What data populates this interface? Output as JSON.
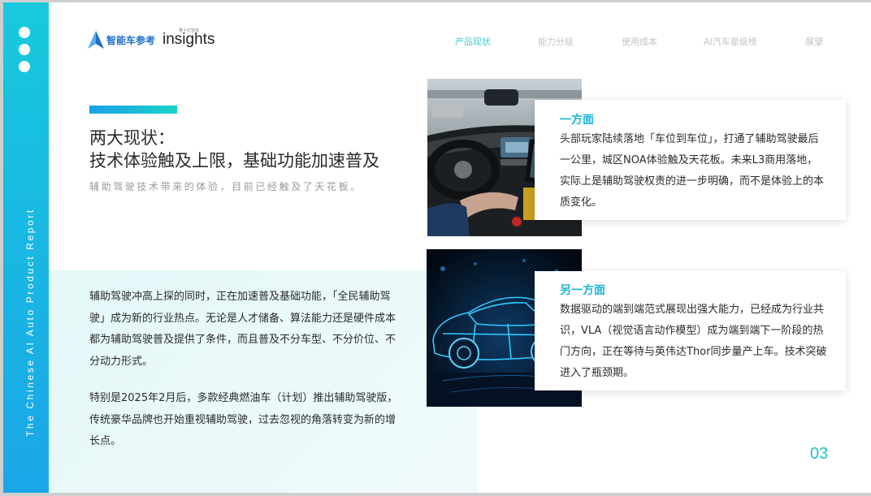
{
  "sidebar": {
    "vertical_text": "The Chinese AI Auto Product Report"
  },
  "logo": {
    "brand_cn": "智能车参考",
    "insights": "insights",
    "insights_tag": "量子位智库"
  },
  "nav": {
    "items": [
      "产品现状",
      "能力分级",
      "使用成本",
      "AI汽车星级榜",
      "展望"
    ],
    "active_index": 0
  },
  "heading": {
    "line1": "两大现状：",
    "line2": "技术体验触及上限，基础功能加速普及",
    "subtitle": "辅助驾驶技术带来的体验，目前已经触及了天花板。"
  },
  "body": {
    "paragraph1": "辅助驾驶冲高上探的同时，正在加速普及基础功能，「全民辅助驾驶」成为新的行业热点。无论是人才储备、算法能力还是硬件成本都为辅助驾驶普及提供了条件，而且普及不分车型、不分价位、不分动力形式。",
    "paragraph2": "特别是2025年2月后，多款经典燃油车（计划）推出辅助驾驶版，传统豪华品牌也开始重视辅助驾驶，过去忽视的角落转变为新的增长点。"
  },
  "cards": [
    {
      "title": "一方面",
      "text": "头部玩家陆续落地「车位到车位」，打通了辅助驾驶最后一公里，城区NOA体验触及天花板。未来L3商用落地，实际上是辅助驾驶权责的进一步明确，而不是体验上的本质变化。"
    },
    {
      "title": "另一方面",
      "text": "数据驱动的端到端范式展现出强大能力，已经成为行业共识，VLA（视觉语言动作模型）成为端到端下一阶段的热门方向，正在等待与英伟达Thor同步量产上车。技术突破进入了瓶颈期。"
    }
  ],
  "page_number": "03",
  "colors": {
    "accent": "#1ec1c8",
    "card_title": "#19b7d8",
    "sidebar_top": "#18c9dc",
    "sidebar_bottom": "#1aa6e8"
  }
}
